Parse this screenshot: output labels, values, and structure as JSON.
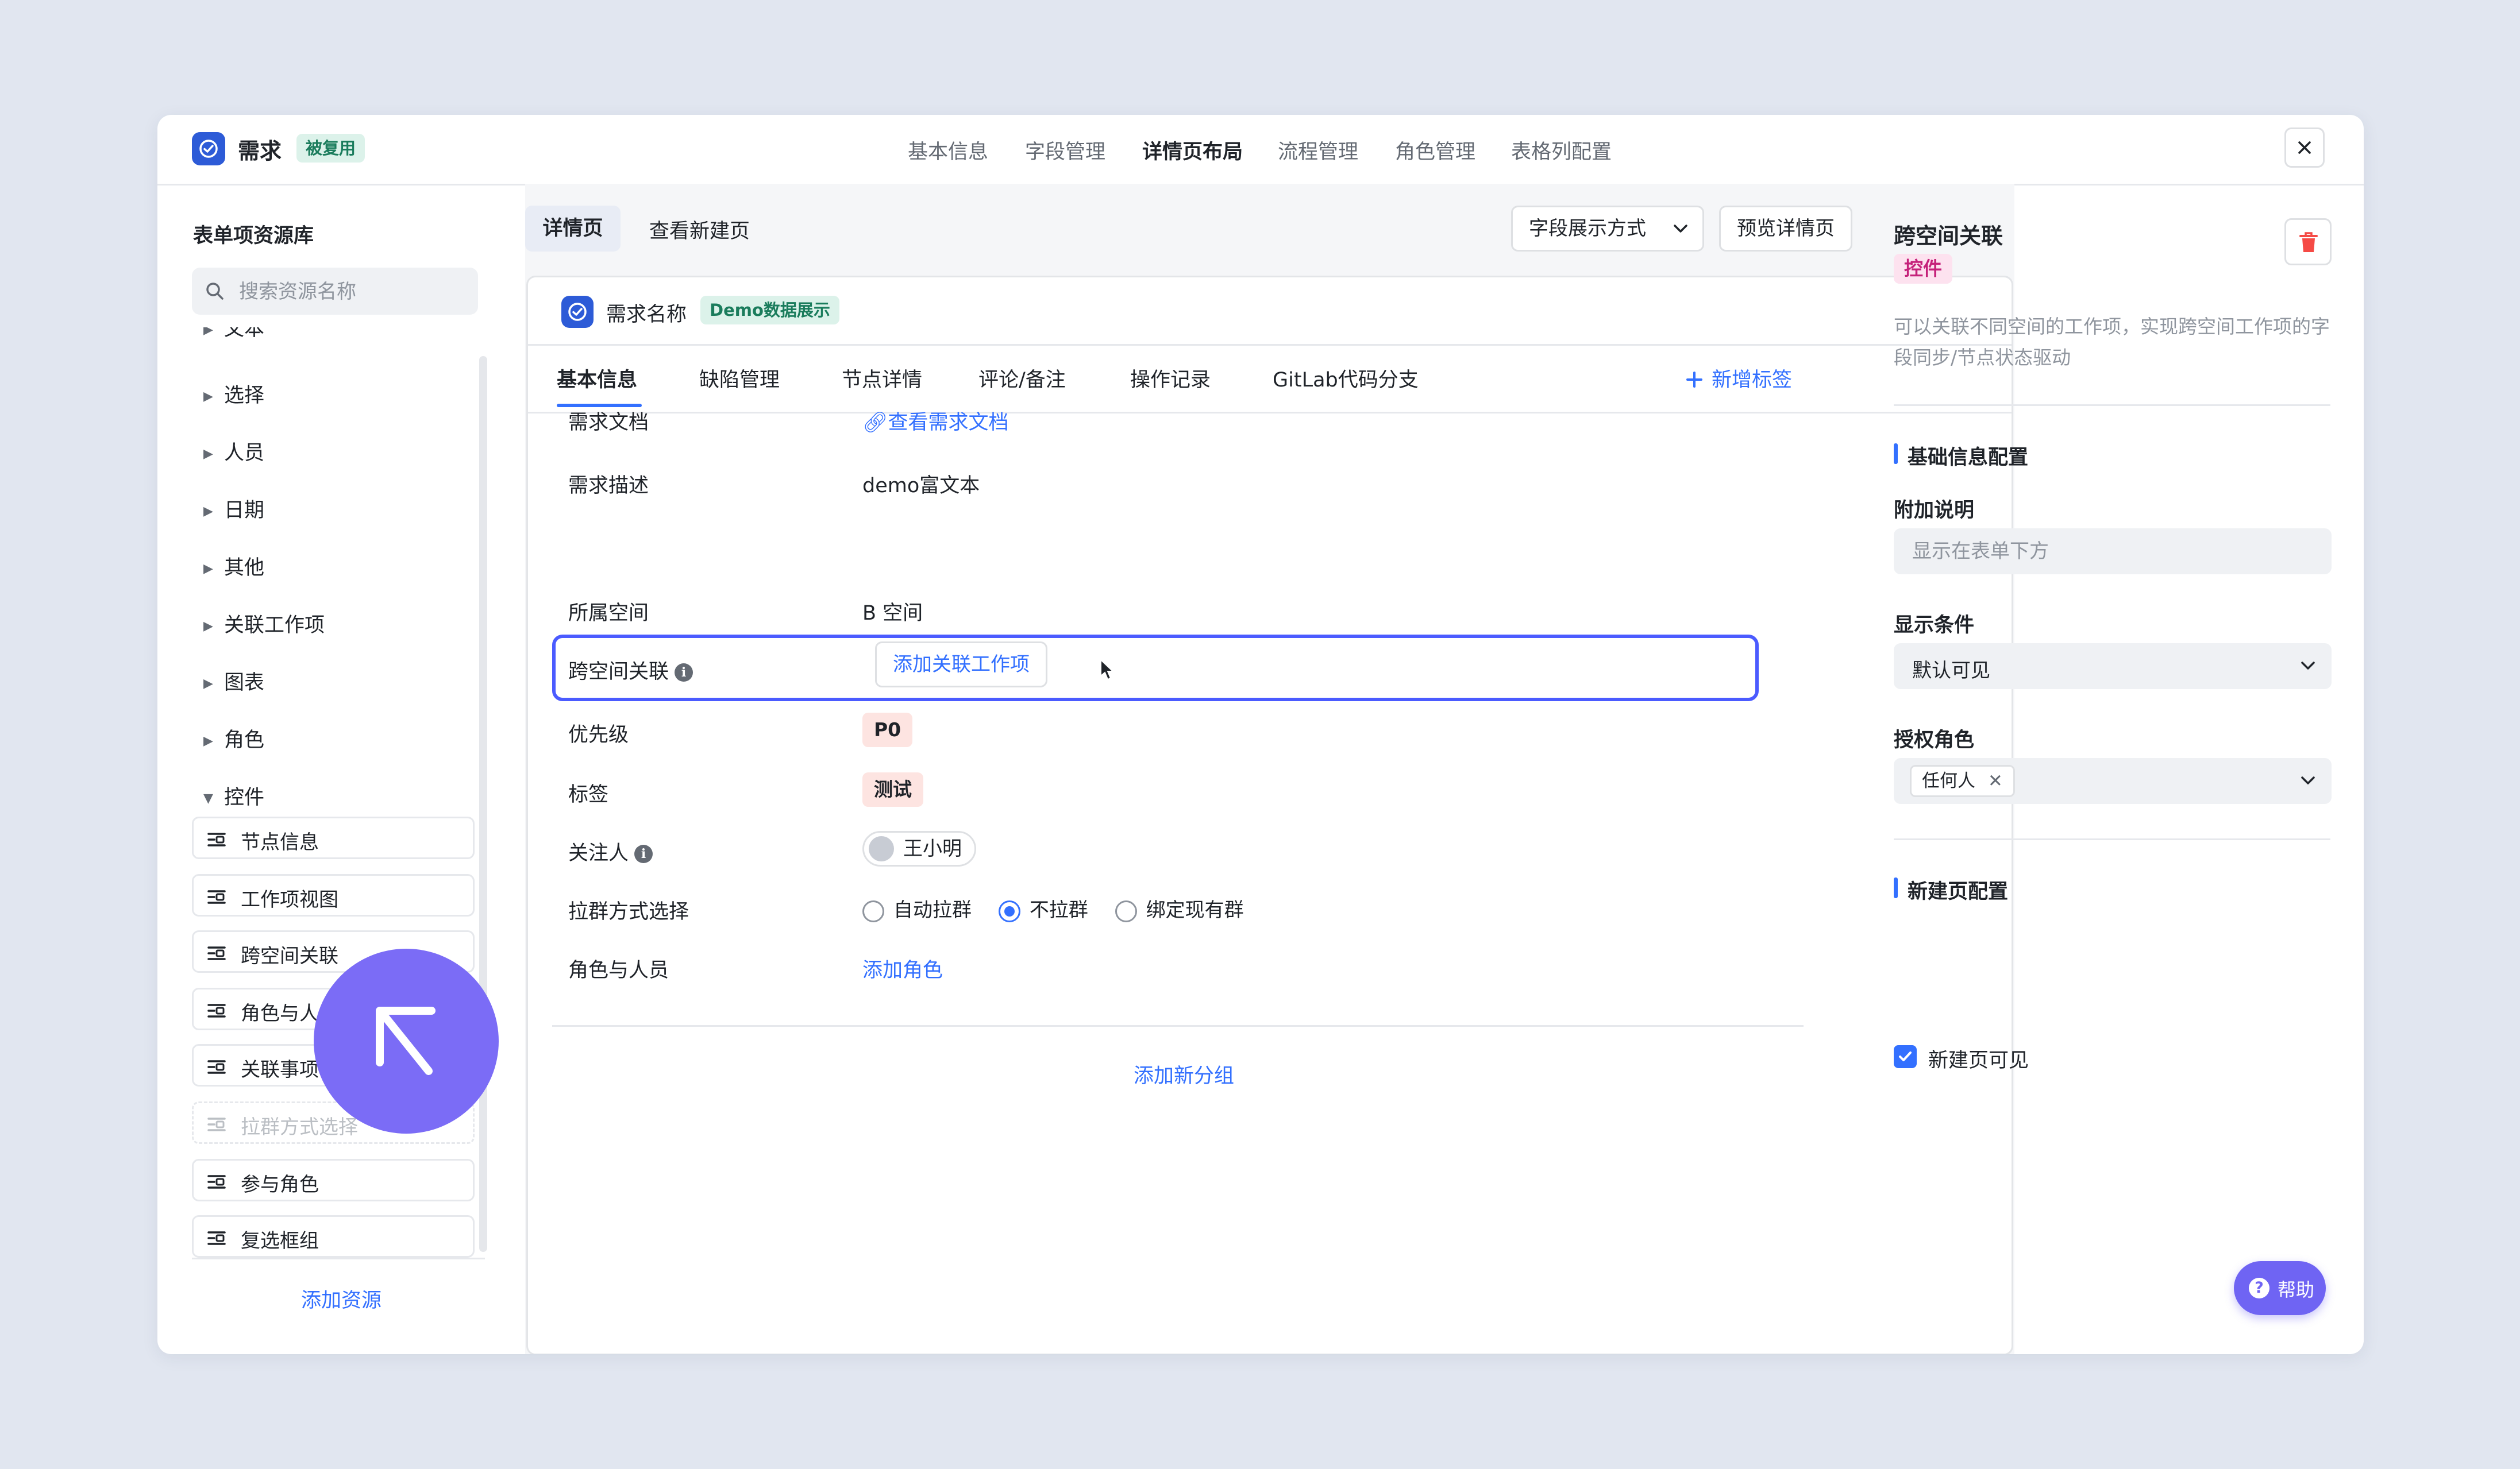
{
  "app": {
    "title": "需求",
    "reuse_badge": "被复用",
    "nav": [
      "基本信息",
      "字段管理",
      "详情页布局",
      "流程管理",
      "角色管理",
      "表格列配置"
    ],
    "active_nav": "详情页布局"
  },
  "sidebar": {
    "title": "表单项资源库",
    "search_placeholder": "搜索资源名称",
    "categories": [
      {
        "label": "文本",
        "expanded": false
      },
      {
        "label": "选择",
        "expanded": false
      },
      {
        "label": "人员",
        "expanded": false
      },
      {
        "label": "日期",
        "expanded": false
      },
      {
        "label": "其他",
        "expanded": false
      },
      {
        "label": "关联工作项",
        "expanded": false
      },
      {
        "label": "图表",
        "expanded": false
      },
      {
        "label": "角色",
        "expanded": false
      },
      {
        "label": "控件",
        "expanded": true
      }
    ],
    "controls": [
      {
        "label": "节点信息",
        "disabled": false
      },
      {
        "label": "工作项视图",
        "disabled": false
      },
      {
        "label": "跨空间关联",
        "disabled": false
      },
      {
        "label": "角色与人员",
        "disabled": false
      },
      {
        "label": "关联事项",
        "disabled": false
      },
      {
        "label": "拉群方式选择",
        "disabled": true
      },
      {
        "label": "参与角色",
        "disabled": false
      },
      {
        "label": "复选框组",
        "disabled": false
      }
    ],
    "add_resource": "添加资源"
  },
  "main": {
    "tabs": [
      "详情页",
      "查看新建页"
    ],
    "field_display_btn": "字段展示方式",
    "preview_btn": "预览详情页",
    "card": {
      "title": "需求名称",
      "badge": "Demo数据展示",
      "tabs": [
        "基本信息",
        "缺陷管理",
        "节点详情",
        "评论/备注",
        "操作记录",
        "GitLab代码分支"
      ],
      "add_tab": "新增标签",
      "fields": {
        "doc_label": "需求文档",
        "doc_link": "查看需求文档",
        "desc_label": "需求描述",
        "desc_value": "demo富文本",
        "space_label": "所属空间",
        "space_value": "B 空间",
        "cross_label": "跨空间关联",
        "cross_btn": "添加关联工作项",
        "priority_label": "优先级",
        "priority_value": "P0",
        "tag_label": "标签",
        "tag_value": "测试",
        "follower_label": "关注人",
        "follower_value": "王小明",
        "group_label": "拉群方式选择",
        "group_options": [
          "自动拉群",
          "不拉群",
          "绑定现有群"
        ],
        "group_selected": "不拉群",
        "role_label": "角色与人员",
        "role_link": "添加角色"
      },
      "add_group": "添加新分组"
    }
  },
  "panel": {
    "title": "跨空间关联",
    "badge": "控件",
    "description": "可以关联不同空间的工作项，实现跨空间工作项的字段同步/节点状态驱动",
    "basic_section": "基础信息配置",
    "note_label": "附加说明",
    "note_placeholder": "显示在表单下方",
    "cond_label": "显示条件",
    "cond_value": "默认可见",
    "role_label": "授权角色",
    "role_chip": "任何人",
    "new_section": "新建页配置",
    "new_visible_label": "新建页可见",
    "new_visible_checked": true
  },
  "help": "帮助",
  "colors": {
    "accent": "#3370ff",
    "selection_border": "#4b5bff",
    "brand_icon": "#2d5bd7",
    "drag_cursor": "#7b6cf6",
    "help_button": "#6f64f3"
  }
}
